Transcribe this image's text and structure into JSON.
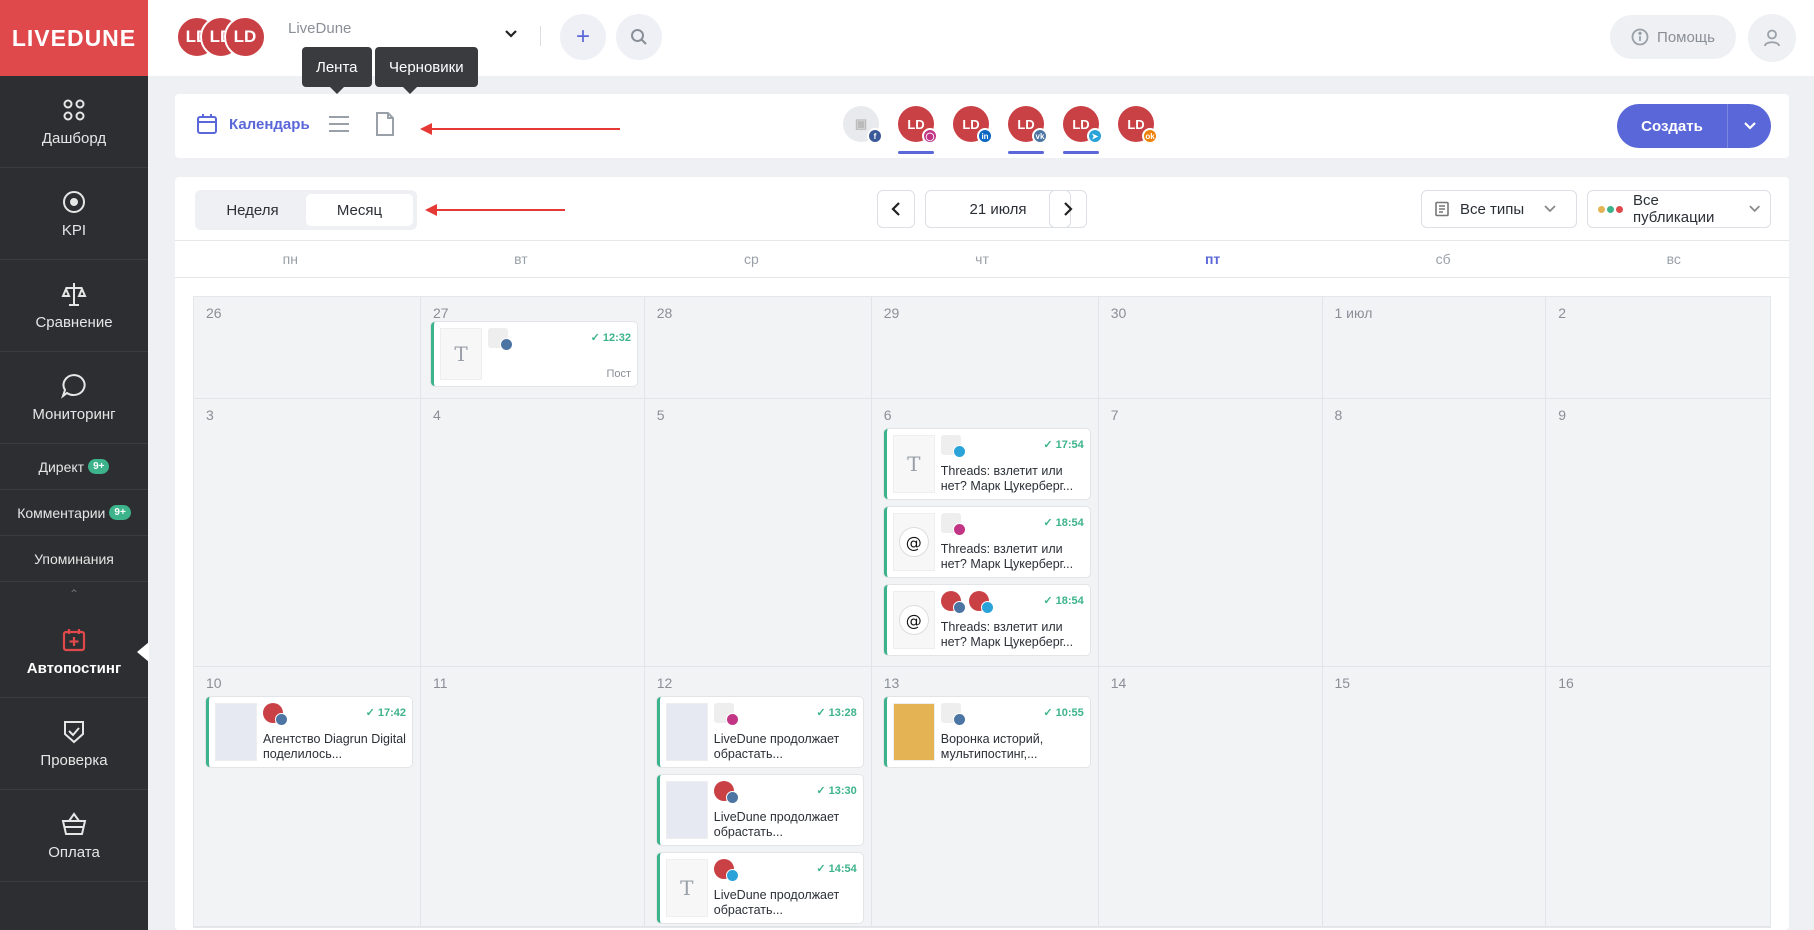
{
  "logo": "LIVEDUNE",
  "sidebar": {
    "items": [
      {
        "label": "Дашборд",
        "icon": "dots-grid-icon"
      },
      {
        "label": "KPI",
        "icon": "target-icon"
      },
      {
        "label": "Сравнение",
        "icon": "scales-icon"
      },
      {
        "label": "Мониторинг",
        "icon": "chat-bubble-icon"
      }
    ],
    "subitems": [
      {
        "label": "Директ",
        "badge": "9+"
      },
      {
        "label": "Комментарии",
        "badge": "9+"
      },
      {
        "label": "Упоминания",
        "badge": ""
      }
    ],
    "items2": [
      {
        "label": "Автопостинг",
        "icon": "calendar-plus-icon",
        "active": true
      },
      {
        "label": "Проверка",
        "icon": "shield-check-icon"
      },
      {
        "label": "Оплата",
        "icon": "basket-icon"
      }
    ]
  },
  "topbar": {
    "avatar_text": "LD",
    "account_name": "LiveDune",
    "help_label": "Помощь"
  },
  "tooltips": {
    "feed": "Лента",
    "drafts": "Черновики"
  },
  "toolbar": {
    "calendar_label": "Календарь",
    "create_label": "Создать",
    "account_text": "LD"
  },
  "period": {
    "week": "Неделя",
    "month": "Месяц"
  },
  "date_label": "21 июля",
  "filters": {
    "types": "Все типы",
    "pubs": "Все публикации"
  },
  "weekdays": [
    "пн",
    "вт",
    "ср",
    "чт",
    "пт",
    "сб",
    "вс"
  ],
  "colors": {
    "accent": "#5a67d8",
    "brand": "#e0494b",
    "success": "#3cb38a",
    "vk": "#4c75a3",
    "instagram": "#c13584",
    "linkedin": "#0a66c2",
    "telegram": "#2aa3d9",
    "ok": "#ee8208",
    "facebook": "#3b5998"
  },
  "calendar": {
    "days": [
      "26",
      "27",
      "28",
      "29",
      "30",
      "1 июл",
      "2",
      "3",
      "4",
      "5",
      "6",
      "7",
      "8",
      "9",
      "10",
      "11",
      "12",
      "13",
      "14",
      "15",
      "16"
    ],
    "posts": {
      "p1": {
        "time": "12:32",
        "type": "Пост",
        "text": ""
      },
      "p2": {
        "time": "17:54",
        "text": "Threads: взлетит или нет? Марк Цукерберг..."
      },
      "p3": {
        "time": "18:54",
        "text": "Threads: взлетит или нет? Марк Цукерберг..."
      },
      "p4": {
        "time": "18:54",
        "text": "Threads: взлетит или нет? Марк Цукерберг..."
      },
      "p5": {
        "time": "17:42",
        "text": "Агентство Diagrun Digital поделилось..."
      },
      "p6": {
        "time": "13:28",
        "text": "LiveDune продолжает обрастать..."
      },
      "p7": {
        "time": "13:30",
        "text": "LiveDune продолжает обрастать..."
      },
      "p8": {
        "time": "14:54",
        "text": "LiveDune продолжает обрастать..."
      },
      "p9": {
        "time": "10:55",
        "text": "Воронка историй, мультипостинг,..."
      }
    }
  }
}
